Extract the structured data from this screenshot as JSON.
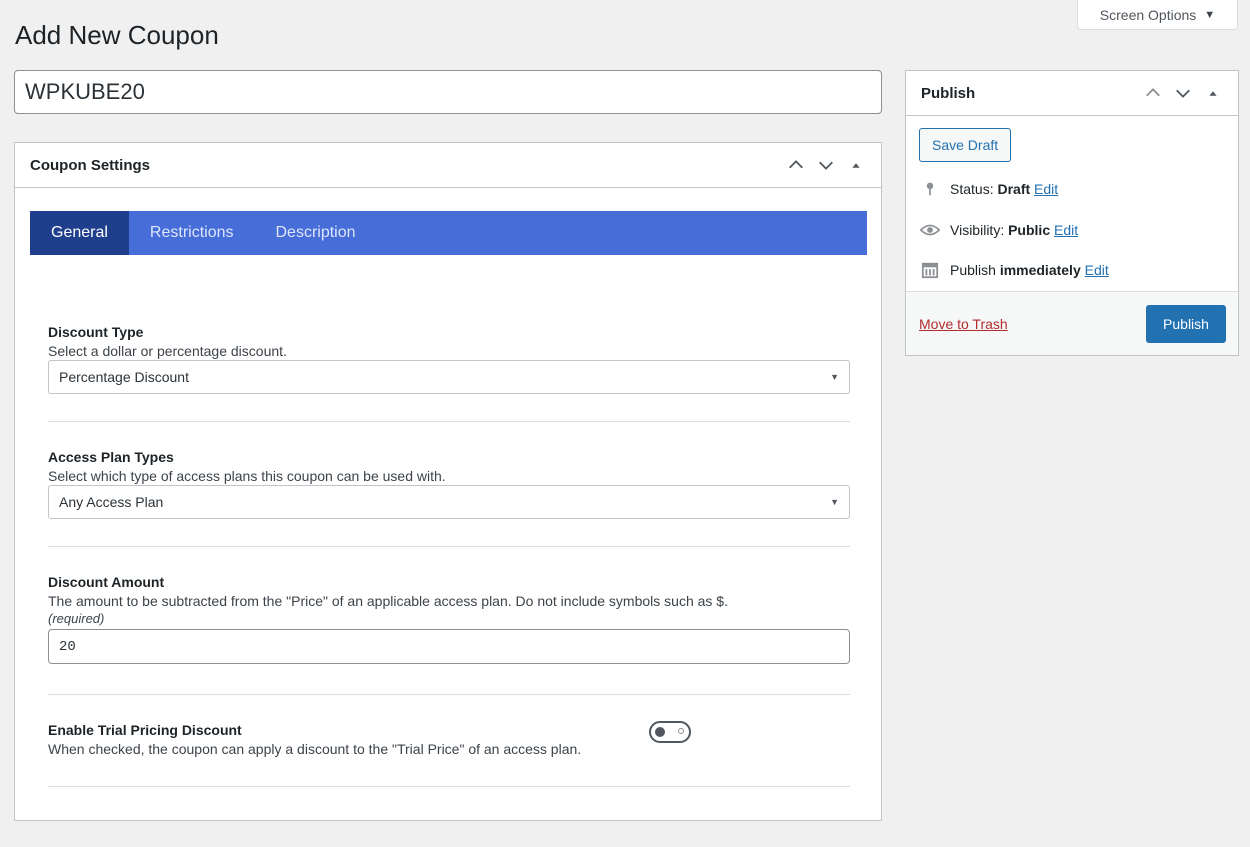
{
  "screen_options": {
    "label": "Screen Options",
    "icon": "triangle-down-icon"
  },
  "page": {
    "title": "Add New Coupon"
  },
  "coupon": {
    "title_value": "WPKUBE20"
  },
  "coupon_settings": {
    "heading": "Coupon Settings",
    "tabs": [
      {
        "label": "General",
        "active": true
      },
      {
        "label": "Restrictions",
        "active": false
      },
      {
        "label": "Description",
        "active": false
      }
    ],
    "discount_type": {
      "label": "Discount Type",
      "description": "Select a dollar or percentage discount.",
      "value": "Percentage Discount"
    },
    "access_plan_types": {
      "label": "Access Plan Types",
      "description": "Select which type of access plans this coupon can be used with.",
      "value": "Any Access Plan"
    },
    "discount_amount": {
      "label": "Discount Amount",
      "description": "The amount to be subtracted from the \"Price\" of an applicable access plan. Do not include symbols such as $.",
      "required_note": "(required)",
      "value": "20"
    },
    "trial_pricing": {
      "label": "Enable Trial Pricing Discount",
      "description": "When checked, the coupon can apply a discount to the \"Trial Price\" of an access plan.",
      "enabled": false
    }
  },
  "publish": {
    "heading": "Publish",
    "save_draft": "Save Draft",
    "status": {
      "label": "Status:",
      "value": "Draft",
      "edit": "Edit",
      "icon": "pin-icon"
    },
    "visibility": {
      "label": "Visibility:",
      "value": "Public",
      "edit": "Edit",
      "icon": "eye-icon"
    },
    "schedule": {
      "label": "Publish",
      "value": "immediately",
      "edit": "Edit",
      "icon": "calendar-icon"
    },
    "trash": "Move to Trash",
    "publish_button": "Publish"
  },
  "colors": {
    "accent": "#2271b1",
    "tab_bar": "#466dd8",
    "tab_active": "#1f3f8c",
    "trash": "#b32d2e"
  }
}
